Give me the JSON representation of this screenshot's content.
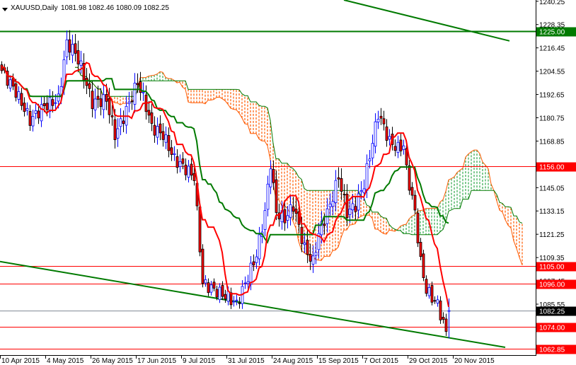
{
  "header": {
    "symbol": "XAUUSD,Daily",
    "ohlc": "1081.98 1082.46 1080.09 1082.25"
  },
  "colors": {
    "bull": "#0000ff",
    "bear": "#ff0000",
    "tenkan": "#ff0000",
    "kijun": "#007a00",
    "cloud_bear": "#ff5a00",
    "cloud_bull": "#2ea84a",
    "support": "#ff0000",
    "resistance": "#007a00",
    "bid": "#808a94"
  },
  "chart_data": {
    "type": "candlestick",
    "title": "XAUUSD,Daily",
    "indicator": "Ichimoku Kinko Hyo",
    "ylim": [
      1062.0,
      1240.9
    ],
    "y_ticks": [
      "1240.25",
      "1228.35",
      "1216.45",
      "1204.55",
      "1192.65",
      "1180.75",
      "1168.85",
      "1145.05",
      "1133.15",
      "1121.25",
      "1109.35",
      "1097.45",
      "1085.55"
    ],
    "x_ticks": [
      {
        "label": "10 Apr 2015",
        "bar": 0
      },
      {
        "label": "4 May 2015",
        "bar": 16
      },
      {
        "label": "26 May 2015",
        "bar": 32
      },
      {
        "label": "17 Jun 2015",
        "bar": 48
      },
      {
        "label": "9 Jul 2015",
        "bar": 64
      },
      {
        "label": "31 Jul 2015",
        "bar": 80
      },
      {
        "label": "24 Aug 2015",
        "bar": 96
      },
      {
        "label": "15 Sep 2015",
        "bar": 112
      },
      {
        "label": "7 Oct 2015",
        "bar": 128
      },
      {
        "label": "29 Oct 2015",
        "bar": 144
      },
      {
        "label": "20 Nov 2015",
        "bar": 160
      }
    ],
    "close_keypoints": [
      [
        0,
        1204.8
      ],
      [
        5,
        1194
      ],
      [
        10,
        1179.5
      ],
      [
        15,
        1186.7
      ],
      [
        20,
        1190
      ],
      [
        23,
        1219
      ],
      [
        26,
        1214
      ],
      [
        28,
        1206.6
      ],
      [
        32,
        1188.5
      ],
      [
        37,
        1190
      ],
      [
        40,
        1172
      ],
      [
        43,
        1181
      ],
      [
        48,
        1199
      ],
      [
        51,
        1186.7
      ],
      [
        53,
        1176
      ],
      [
        57,
        1172
      ],
      [
        61,
        1159.6
      ],
      [
        64,
        1156
      ],
      [
        68,
        1150.6
      ],
      [
        71,
        1096.4
      ],
      [
        75,
        1092.8
      ],
      [
        80,
        1089
      ],
      [
        83,
        1085.5
      ],
      [
        86,
        1096
      ],
      [
        90,
        1110.8
      ],
      [
        93,
        1132.5
      ],
      [
        95,
        1157.8
      ],
      [
        97,
        1132.5
      ],
      [
        100,
        1129
      ],
      [
        103,
        1136
      ],
      [
        107,
        1114
      ],
      [
        110,
        1107
      ],
      [
        112,
        1121.7
      ],
      [
        116,
        1136
      ],
      [
        119,
        1150.6
      ],
      [
        122,
        1132.5
      ],
      [
        125,
        1136
      ],
      [
        128,
        1147
      ],
      [
        131,
        1168.6
      ],
      [
        133,
        1183
      ],
      [
        135,
        1176
      ],
      [
        137,
        1168.6
      ],
      [
        140,
        1165
      ],
      [
        142,
        1166.8
      ],
      [
        143,
        1154
      ],
      [
        146,
        1132.5
      ],
      [
        148,
        1107
      ],
      [
        150,
        1092.8
      ],
      [
        152,
        1089
      ],
      [
        154,
        1085.5
      ],
      [
        157,
        1071
      ],
      [
        158,
        1082.25
      ]
    ],
    "last_price": 1082.25,
    "horizontal_levels": [
      {
        "price": 1225.0,
        "label": "1225.00",
        "kind": "resistance"
      },
      {
        "price": 1156.0,
        "label": "1156.00",
        "kind": "support"
      },
      {
        "price": 1105.0,
        "label": "1105.00",
        "kind": "support"
      },
      {
        "price": 1096.0,
        "label": "1096.00",
        "kind": "support"
      },
      {
        "price": 1074.0,
        "label": "1074.00",
        "kind": "support"
      },
      {
        "price": 1062.85,
        "label": "1062.85",
        "kind": "support"
      }
    ],
    "bid_label": "1082.25",
    "trendlines": [
      {
        "from": [
          -0.5,
          1107.3
        ],
        "to": [
          178,
          1063.5
        ]
      },
      {
        "from": [
          121,
          1240.9
        ],
        "to": [
          179.5,
          1220
        ]
      }
    ]
  }
}
